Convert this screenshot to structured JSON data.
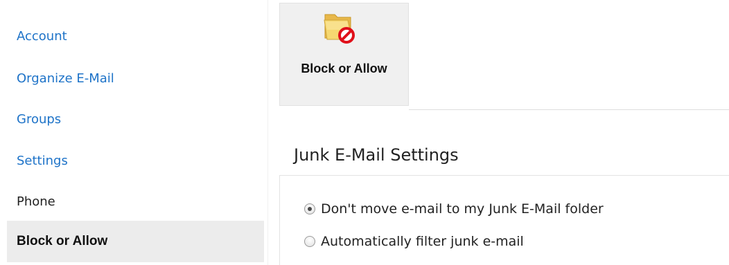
{
  "nav": {
    "items": [
      {
        "label": "Account"
      },
      {
        "label": "Organize E-Mail"
      },
      {
        "label": "Groups"
      },
      {
        "label": "Settings"
      },
      {
        "label": "Phone"
      },
      {
        "label": "Block or Allow"
      }
    ],
    "active": "Block or Allow"
  },
  "ribbon": {
    "button_label": "Block or Allow",
    "icon": "folder-block-icon"
  },
  "junk": {
    "title": "Junk E-Mail Settings",
    "options": [
      {
        "label": "Don't move e-mail to my Junk E-Mail folder",
        "selected": true
      },
      {
        "label": "Automatically filter junk e-mail",
        "selected": false
      }
    ]
  },
  "colors": {
    "link": "#1e73c8",
    "active_bg": "#ececec",
    "ribbon_bg": "#f0f0f0",
    "block_red": "#e0101a",
    "folder_yellow": "#f3cf5d"
  }
}
